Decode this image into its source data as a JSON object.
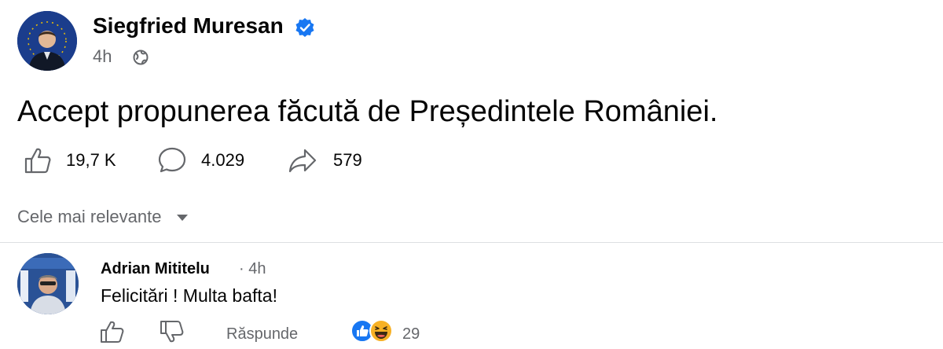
{
  "post": {
    "author": "Siegfried Muresan",
    "time": "4h",
    "text": "Accept propunerea făcută de Președintele României.",
    "stats": {
      "likes": "19,7 K",
      "comments": "4.029",
      "shares": "579"
    }
  },
  "sort": {
    "label": "Cele mai relevante"
  },
  "comment": {
    "author": "Adrian Mititelu",
    "meta": "· 4h",
    "text": "Felicitări ! Multa bafta!",
    "reply_label": "Răspunde",
    "reaction_count": "29"
  },
  "icons": {
    "verified": "verified-badge-icon",
    "audience": "globe-icon",
    "like": "thumbs-up-icon",
    "comment": "comment-bubble-icon",
    "share": "share-arrow-icon",
    "sort": "caret-down-icon",
    "dislike": "thumbs-down-icon"
  },
  "colors": {
    "verified_blue": "#1877f2",
    "secondary_text": "#65676b",
    "haha_yellow": "#f7b125"
  }
}
